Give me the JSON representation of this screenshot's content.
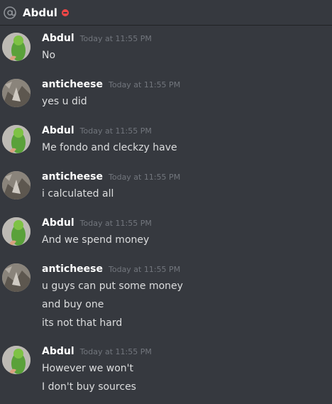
{
  "channel": {
    "name": "Abdul",
    "status": "do-not-disturb",
    "status_color": "#f04747"
  },
  "colors": {
    "background": "#36393f",
    "timestamp": "#72767d",
    "text": "#dcddde"
  },
  "messages": [
    {
      "author": "Abdul",
      "avatar": "parrot-avatar",
      "timestamp": "Today at 11:55 PM",
      "lines": [
        "No"
      ]
    },
    {
      "author": "anticheese",
      "avatar": "rock-avatar",
      "timestamp": "Today at 11:55 PM",
      "lines": [
        "yes u did"
      ]
    },
    {
      "author": "Abdul",
      "avatar": "parrot-avatar",
      "timestamp": "Today at 11:55 PM",
      "lines": [
        "Me fondo and cleckzy have"
      ]
    },
    {
      "author": "anticheese",
      "avatar": "rock-avatar",
      "timestamp": "Today at 11:55 PM",
      "lines": [
        "i calculated all"
      ]
    },
    {
      "author": "Abdul",
      "avatar": "parrot-avatar",
      "timestamp": "Today at 11:55 PM",
      "lines": [
        "And we spend money"
      ]
    },
    {
      "author": "anticheese",
      "avatar": "rock-avatar",
      "timestamp": "Today at 11:55 PM",
      "lines": [
        "u guys can put some money",
        "and buy one",
        "its not that hard"
      ]
    },
    {
      "author": "Abdul",
      "avatar": "parrot-avatar",
      "timestamp": "Today at 11:55 PM",
      "lines": [
        "However we won't",
        "I don't buy sources"
      ]
    }
  ]
}
